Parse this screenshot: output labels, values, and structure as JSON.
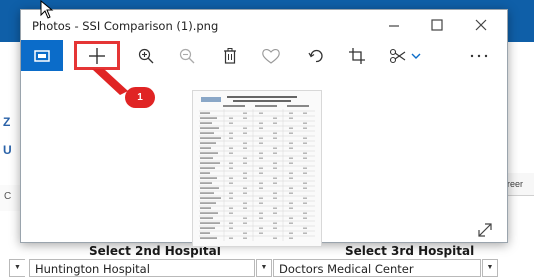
{
  "window": {
    "title": "Photos - SSI Comparison (1).png",
    "buttons": {
      "minimize": "minimize",
      "maximize": "maximize",
      "close": "close"
    }
  },
  "toolbar": {
    "tools": [
      {
        "name": "slideshow-icon",
        "active": true
      },
      {
        "name": "add-icon",
        "highlighted": true
      },
      {
        "name": "zoom-in-icon"
      },
      {
        "name": "zoom-out-icon"
      },
      {
        "name": "delete-icon"
      },
      {
        "name": "favorite-icon"
      },
      {
        "name": "rotate-icon"
      },
      {
        "name": "crop-icon"
      },
      {
        "name": "edit-icon"
      },
      {
        "name": "more-icon"
      }
    ],
    "accent": "#0b6cc9"
  },
  "annotation": {
    "label": "1",
    "color": "#e02424"
  },
  "background_app": {
    "selects": [
      {
        "title": "Select 2nd Hospital",
        "value": "Huntington Hospital"
      },
      {
        "title": "Select 3rd Hospital",
        "value": "Doctors Medical Center"
      }
    ],
    "screen_tab_label": "l Screer",
    "left_tab_label": "C",
    "left_glyphs": [
      "Z",
      "U",
      "C"
    ]
  }
}
